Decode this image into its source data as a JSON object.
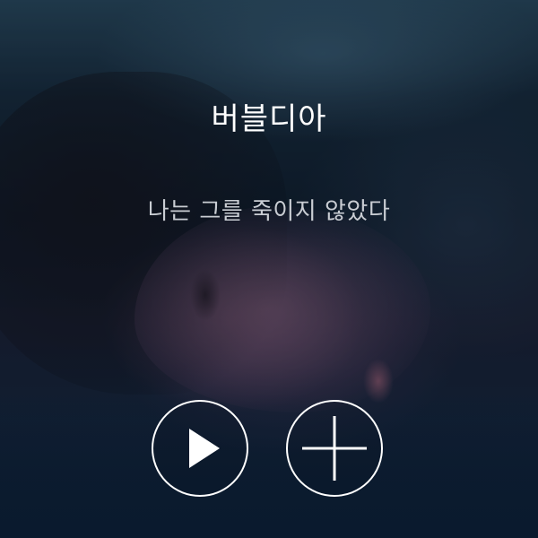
{
  "album": {
    "artist": "버블디아",
    "title": "나는 그를 죽이지 않았다"
  },
  "controls": {
    "play_icon": "play-icon",
    "add_icon": "plus-icon"
  },
  "colors": {
    "text_primary": "#ffffff",
    "text_secondary": "#c9cdd3",
    "button_outline": "#ffffff"
  }
}
